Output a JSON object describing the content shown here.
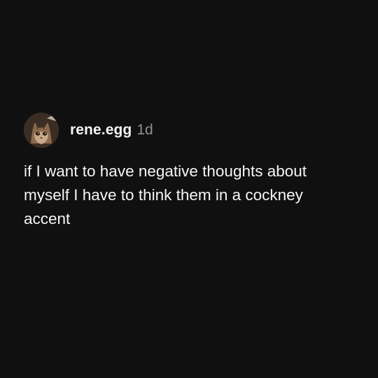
{
  "post": {
    "avatar_icon": "cat-avatar-icon",
    "username": "rene.egg",
    "timestamp": "1d",
    "text": "if I want to have negative thoughts about\nmyself I have to think them in a cockney\naccent"
  },
  "colors": {
    "background": "#101010",
    "text": "#f5f5f5",
    "muted": "#8e8e8e"
  }
}
